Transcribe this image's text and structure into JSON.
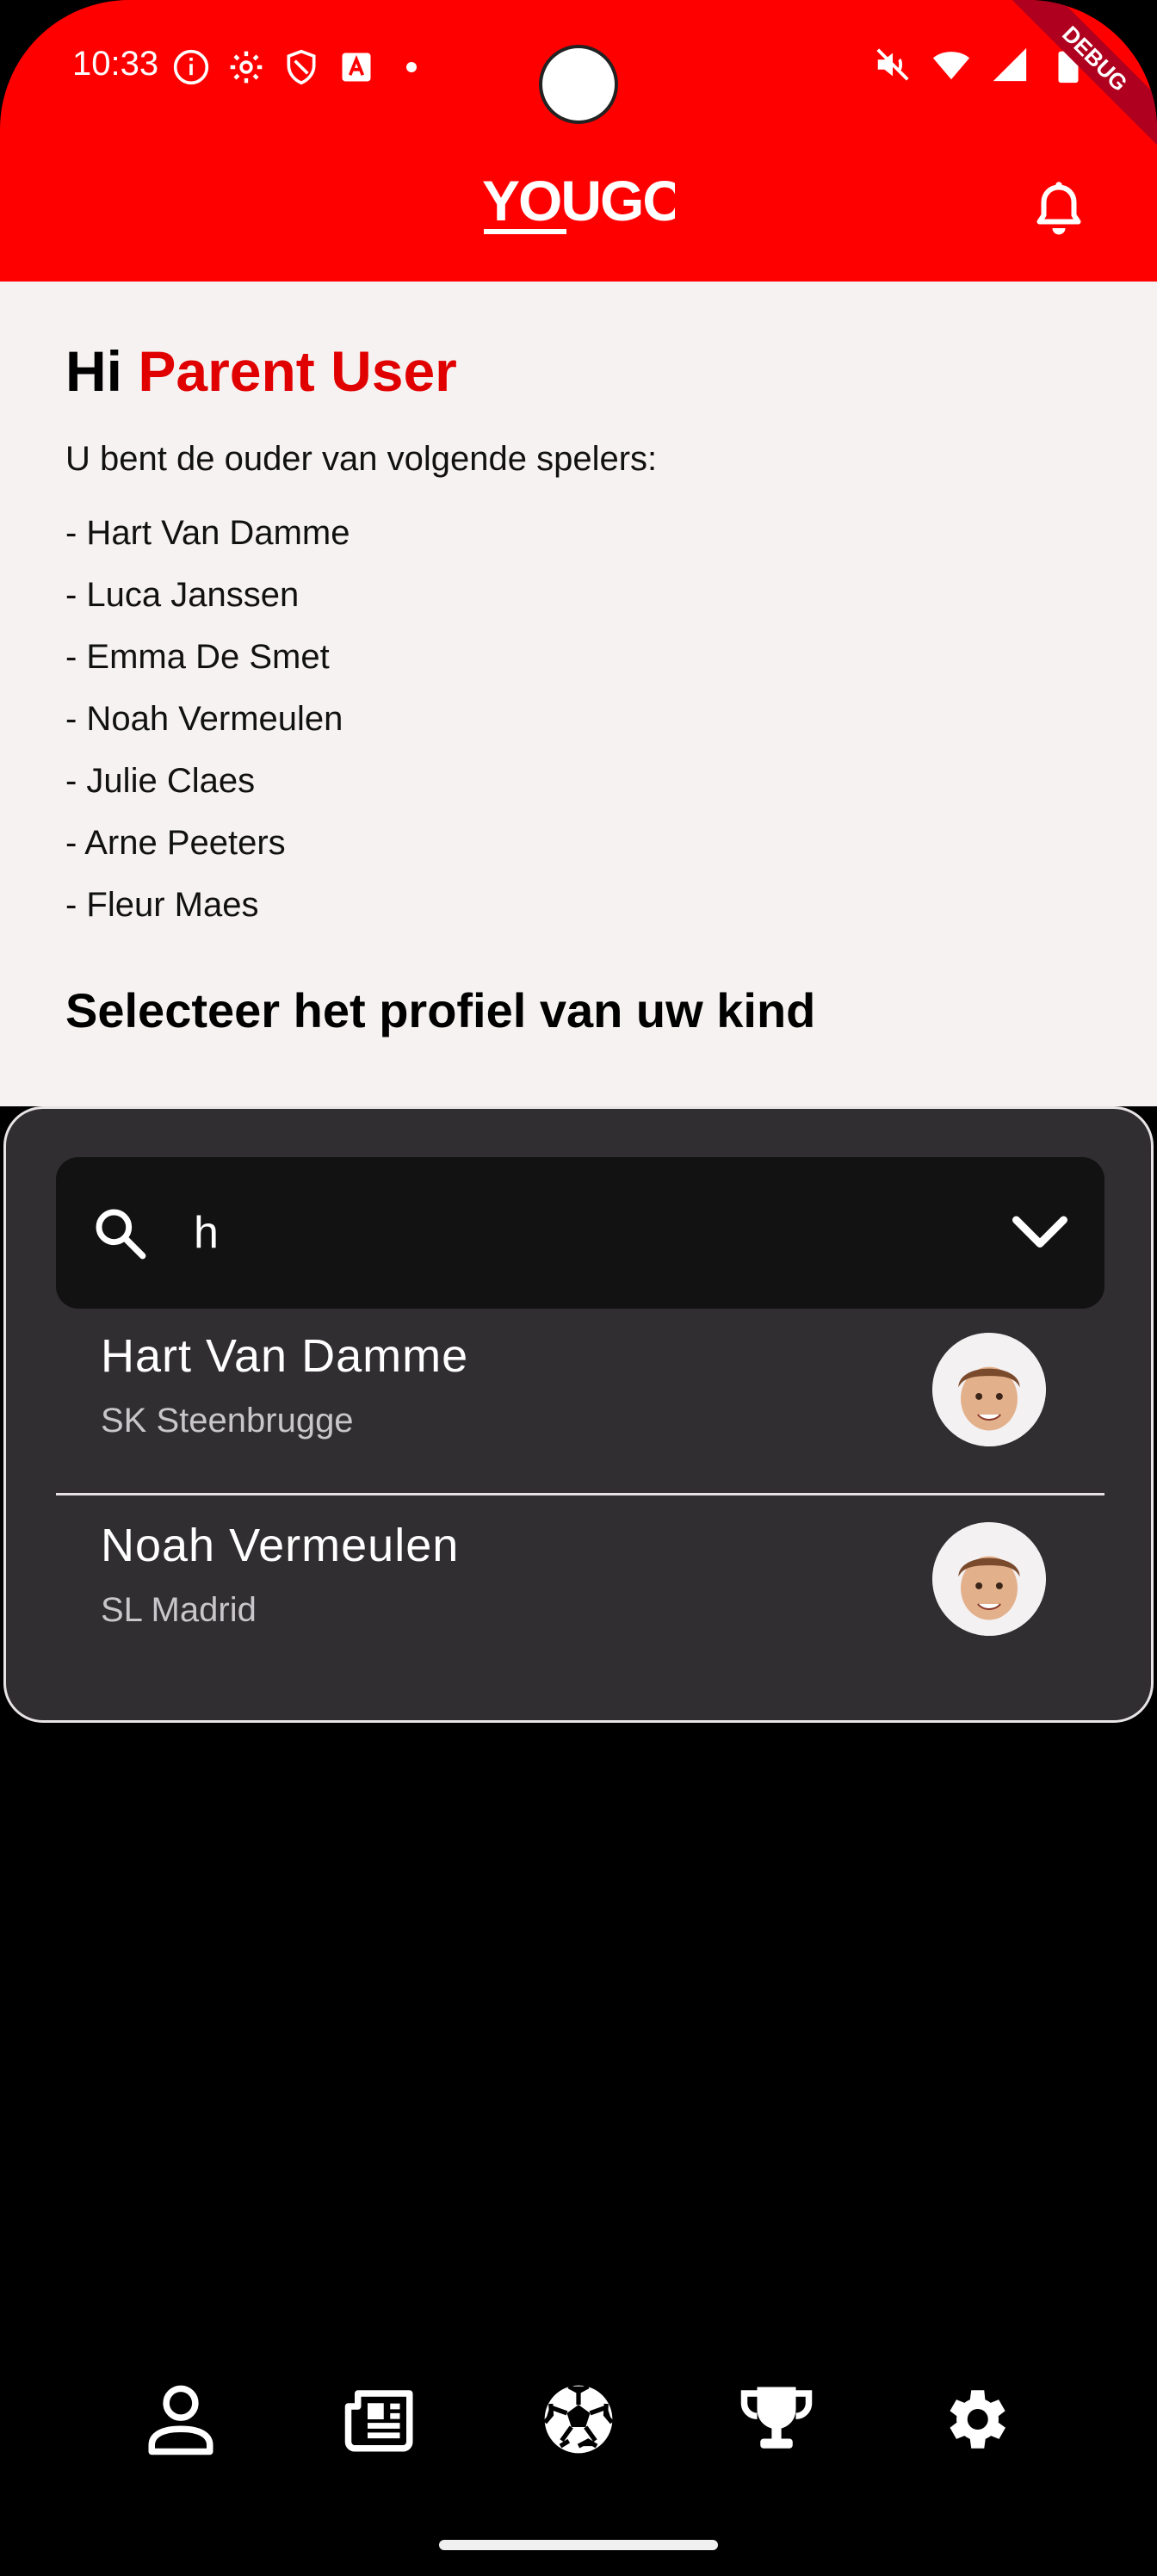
{
  "status_bar": {
    "time": "10:33",
    "left_icons": [
      "info-icon",
      "settings-gear-icon",
      "shield-icon",
      "app-a-icon",
      "dot-icon"
    ],
    "right_icons": [
      "mute-icon",
      "wifi-icon",
      "signal-icon",
      "battery-icon"
    ]
  },
  "debug_ribbon": "DEBUG",
  "header": {
    "logo_text": "YOUGO",
    "brand_color": "#ff0000",
    "notification_icon": "bell-icon"
  },
  "greeting": {
    "hi": "Hi",
    "user_name": "Parent User"
  },
  "intro": "U bent de ouder van volgende spelers:",
  "players": [
    "- Hart Van Damme",
    "- Luca Janssen",
    "- Emma De Smet",
    "- Noah Vermeulen",
    "- Julie Claes",
    "- Arne Peeters",
    "- Fleur Maes"
  ],
  "select_title": "Selecteer het profiel van uw kind",
  "search": {
    "value": "h",
    "icon": "search-icon",
    "toggle_icon": "chevron-down-icon"
  },
  "options": [
    {
      "name": "Hart Van Damme",
      "club": "SK Steenbrugge",
      "avatar": "memoji-boy-avatar"
    },
    {
      "name": "Noah Vermeulen",
      "club": "SL Madrid",
      "avatar": "memoji-boy-avatar"
    }
  ],
  "bottom_nav": [
    {
      "id": "profile",
      "icon": "person-icon"
    },
    {
      "id": "news",
      "icon": "newspaper-icon"
    },
    {
      "id": "matches",
      "icon": "soccer-ball-icon"
    },
    {
      "id": "trophies",
      "icon": "trophy-icon"
    },
    {
      "id": "settings",
      "icon": "settings-gear-icon"
    }
  ]
}
